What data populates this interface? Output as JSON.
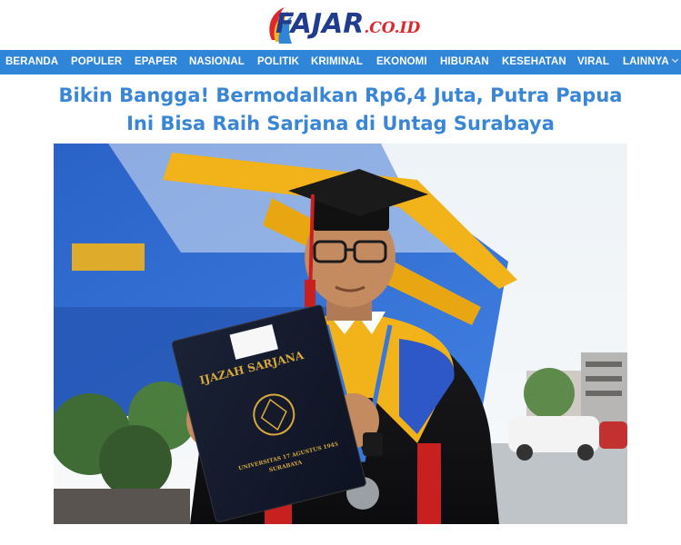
{
  "site": {
    "logo_text": "FAJAR",
    "logo_suffix": ".CO.ID",
    "brand_color": "#1f3c8f",
    "accent_color": "#e0262c"
  },
  "nav": {
    "background": "#2f86d9",
    "items": [
      {
        "label": "BERANDA"
      },
      {
        "label": "POPULER"
      },
      {
        "label": "EPAPER"
      },
      {
        "label": "NASIONAL"
      },
      {
        "label": "POLITIK"
      },
      {
        "label": "KRIMINAL"
      },
      {
        "label": "EKONOMI"
      },
      {
        "label": "HIBURAN"
      },
      {
        "label": "KESEHATAN"
      },
      {
        "label": "VIRAL"
      },
      {
        "label": "LAINNYA",
        "icon": "chevron-down-icon"
      }
    ]
  },
  "article": {
    "title_line1": "Bikin Bangga! Bermodalkan Rp6,4 Juta, Putra Papua",
    "title_line2": "Ini Bisa Raih Sarjana di Untag Surabaya",
    "title_color": "#3a86d6",
    "photo": {
      "folder_title": "IJAZAH SARJANA",
      "university_line1": "UNIVERSITAS 17 AGUSTUS 1945",
      "university_line2": "SURABAYA"
    }
  }
}
